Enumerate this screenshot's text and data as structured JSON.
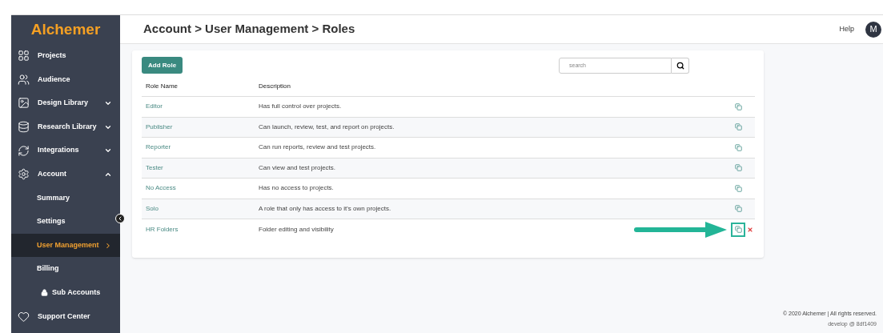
{
  "sidebar": {
    "logo": "Alchemer",
    "items": [
      {
        "kind": "main",
        "label": "Projects",
        "selected": false
      },
      {
        "kind": "main",
        "label": "Audience",
        "selected": false
      },
      {
        "kind": "main",
        "label": "Design Library",
        "selected": false,
        "expanded": false
      },
      {
        "kind": "main",
        "label": "Research Library",
        "selected": false,
        "expanded": false
      },
      {
        "kind": "main",
        "label": "Integrations",
        "selected": false,
        "expanded": false
      },
      {
        "kind": "main",
        "label": "Account",
        "selected": false,
        "expanded": true
      },
      {
        "kind": "sub",
        "label": "Summary",
        "selected": false
      },
      {
        "kind": "sub",
        "label": "Settings",
        "selected": false
      },
      {
        "kind": "sub",
        "label": "User Management",
        "selected": true
      },
      {
        "kind": "sub",
        "label": "Billing",
        "selected": false
      },
      {
        "kind": "sub",
        "label": "Sub Accounts",
        "selected": false,
        "locked": true
      },
      {
        "kind": "main",
        "label": "Support Center",
        "selected": false
      }
    ]
  },
  "header": {
    "breadcrumb": "Account > User Management > Roles",
    "help": "Help",
    "avatar": "M"
  },
  "toolbar": {
    "add_button": "Add Role",
    "search": {
      "placeholder": "search"
    }
  },
  "table": {
    "columns": [
      "Role Name",
      "Description"
    ],
    "rows": [
      {
        "name": "Editor",
        "description": "Has full control over projects.",
        "highlighted": false,
        "deletable": false
      },
      {
        "name": "Publisher",
        "description": "Can launch, review, test, and report on projects.",
        "highlighted": false,
        "deletable": false
      },
      {
        "name": "Reporter",
        "description": "Can run reports, review and test projects.",
        "highlighted": false,
        "deletable": false
      },
      {
        "name": "Tester",
        "description": "Can view and test projects.",
        "highlighted": false,
        "deletable": false
      },
      {
        "name": "No Access",
        "description": "Has no access to projects.",
        "highlighted": false,
        "deletable": false
      },
      {
        "name": "Solo",
        "description": "A role that only has access to it's own projects.",
        "highlighted": false,
        "deletable": false
      },
      {
        "name": "HR Folders",
        "description": "Folder editing and visibility",
        "highlighted": true,
        "deletable": true
      }
    ]
  },
  "footer": {
    "copyright": "© 2020 Alchemer | All rights reserved.",
    "build": "develop @ 8df1409"
  }
}
